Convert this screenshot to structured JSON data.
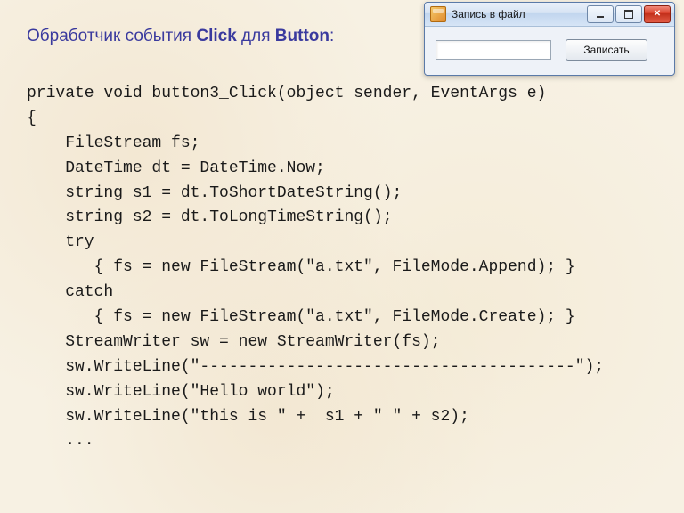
{
  "heading": {
    "part1": "Обработчик события ",
    "click": "Click",
    "part2": " для ",
    "button": "Button",
    "colon": ":"
  },
  "code": "private void button3_Click(object sender, EventArgs e)\n{\n    FileStream fs;\n    DateTime dt = DateTime.Now;\n    string s1 = dt.ToShortDateString();\n    string s2 = dt.ToLongTimeString();\n    try\n       { fs = new FileStream(\"a.txt\", FileMode.Append); }\n    catch\n       { fs = new FileStream(\"a.txt\", FileMode.Create); }\n    StreamWriter sw = new StreamWriter(fs);\n    sw.WriteLine(\"---------------------------------------\");\n    sw.WriteLine(\"Hello world\");\n    sw.WriteLine(\"this is \" +  s1 + \" \" + s2);\n    ...",
  "window": {
    "title": "Запись в файл",
    "textbox_value": "",
    "button_label": "Записать",
    "close_glyph": "✕"
  }
}
